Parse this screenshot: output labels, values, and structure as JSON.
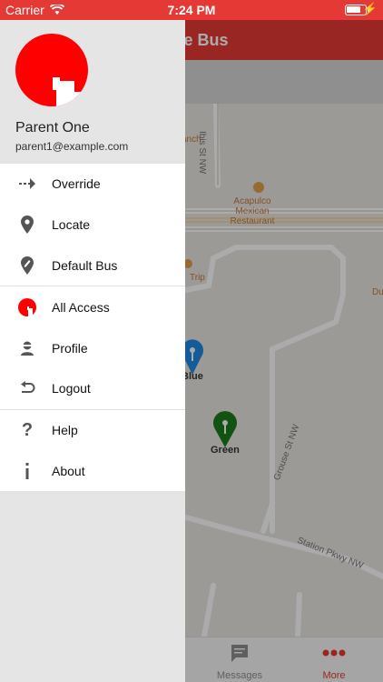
{
  "status_bar": {
    "carrier": "Carrier",
    "time": "7:24 PM"
  },
  "app": {
    "title": "te Bus",
    "map_labels": {
      "ranch": "anch",
      "ibis": "Ibis St NW",
      "restaurant": "Acapulco Mexican Restaurant",
      "trip": "Trip",
      "du": "Du",
      "grouse": "Grouse St NW",
      "station": "Station Pkwy NW",
      "blue": "Blue",
      "green": "Green"
    },
    "tabs": {
      "messages": "Messages",
      "more": "More"
    }
  },
  "drawer": {
    "user": {
      "name": "Parent One",
      "email": "parent1@example.com"
    },
    "menu": [
      {
        "label": "Override",
        "icon": "arrow-right-icon"
      },
      {
        "label": "Locate",
        "icon": "location-pin-icon"
      },
      {
        "label": "Default Bus",
        "icon": "pin-pencil-icon"
      },
      {
        "label": "All Access",
        "icon": "all-access-icon"
      },
      {
        "label": "Profile",
        "icon": "profile-icon"
      },
      {
        "label": "Logout",
        "icon": "undo-arrow-icon"
      },
      {
        "label": "Help",
        "icon": "question-icon"
      },
      {
        "label": "About",
        "icon": "info-icon"
      }
    ]
  },
  "colors": {
    "accent": "#e53935",
    "brand_red": "#ff0000",
    "pin_blue": "#1e88e5",
    "pin_green": "#1b7d1b"
  }
}
